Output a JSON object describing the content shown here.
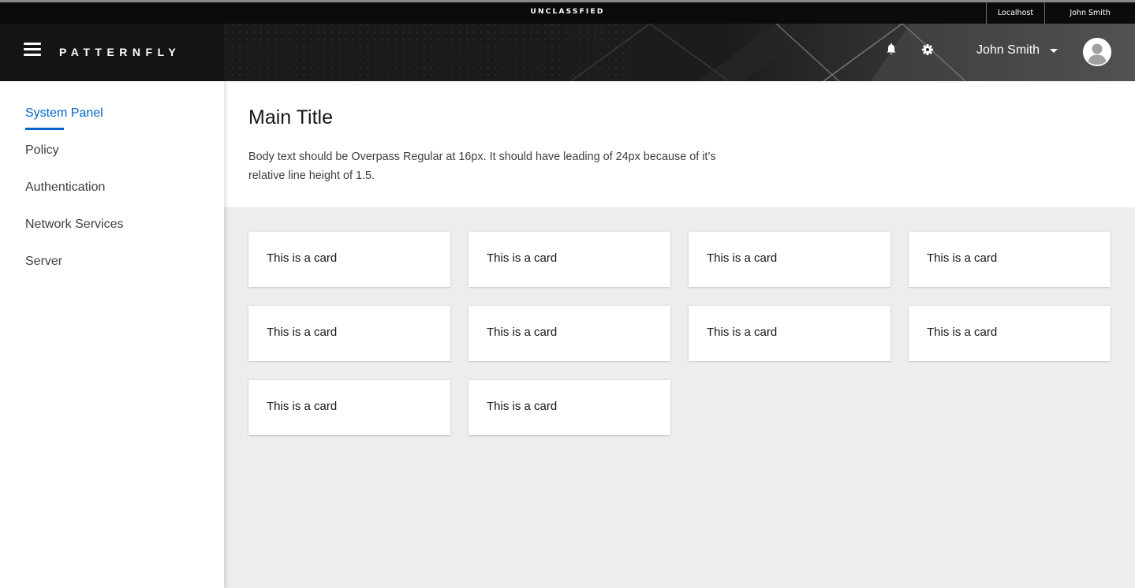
{
  "classification_banner": {
    "label": "UNCLASSFIED",
    "host": "Localhost",
    "user": "John Smith"
  },
  "masthead": {
    "brand": "PATTERNFLY",
    "user_name": "John Smith",
    "icons": [
      "hamburger-menu-icon",
      "bell-icon",
      "gear-icon",
      "caret-down-icon",
      "avatar-icon"
    ]
  },
  "sidebar": {
    "items": [
      {
        "label": "System Panel",
        "active": true
      },
      {
        "label": "Policy",
        "active": false
      },
      {
        "label": "Authentication",
        "active": false
      },
      {
        "label": "Network Services",
        "active": false
      },
      {
        "label": "Server",
        "active": false
      }
    ]
  },
  "page": {
    "title": "Main Title",
    "body": "Body text should be Overpass Regular at 16px. It should have leading of 24px because of it’s relative line height of 1.5."
  },
  "cards": [
    {
      "text": "This is a card"
    },
    {
      "text": "This is a card"
    },
    {
      "text": "This is a card"
    },
    {
      "text": "This is a card"
    },
    {
      "text": "This is a card"
    },
    {
      "text": "This is a card"
    },
    {
      "text": "This is a card"
    },
    {
      "text": "This is a card"
    },
    {
      "text": "This is a card"
    },
    {
      "text": "This is a card"
    }
  ],
  "colors": {
    "accent": "#0066cc",
    "masthead": "#151515",
    "content_background": "#ededed"
  }
}
